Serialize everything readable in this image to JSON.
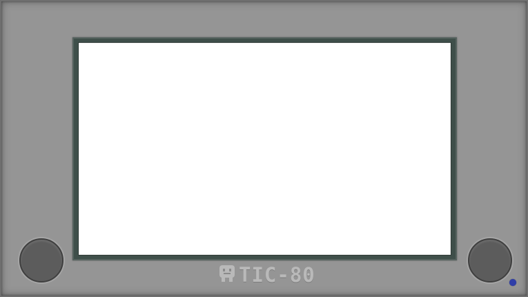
{
  "app": {
    "logo_text": "TIC-80",
    "logo_icon": "tic80-face-icon"
  },
  "colors": {
    "body": "#959595",
    "bezel": "#3f4f4a",
    "screen": "#ffffff",
    "knob": "#5c5c5c",
    "logo": "#b9b9b9",
    "status_dot": "#2f3ea8"
  }
}
